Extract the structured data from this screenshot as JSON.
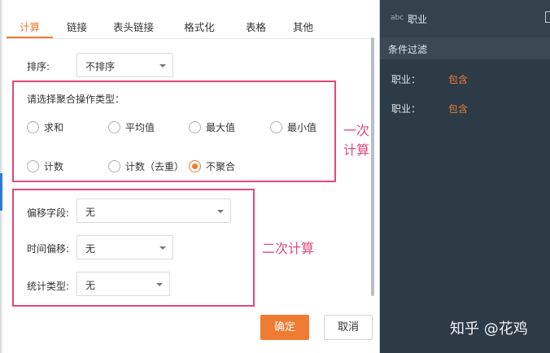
{
  "tabs": [
    "计算",
    "链接",
    "表头链接",
    "格式化",
    "表格",
    "其他"
  ],
  "sort": {
    "label": "排序:",
    "value": "不排序"
  },
  "aggregate": {
    "title": "请选择聚合操作类型：",
    "options": [
      "求和",
      "平均值",
      "最大值",
      "最小值",
      "计数",
      "计数（去重）",
      "不聚合"
    ],
    "selected": "不聚合"
  },
  "offset_field": {
    "label": "偏移字段:",
    "value": "无"
  },
  "time_offset": {
    "label": "时间偏移:",
    "value": "无"
  },
  "stat_type": {
    "label": "统计类型:",
    "value": "无"
  },
  "annotations": {
    "first": "一次计算",
    "second": "二次计算"
  },
  "buttons": {
    "ok": "确定",
    "cancel": "取消"
  },
  "right_panel": {
    "abc": "abc",
    "title": "职业",
    "section": "条件过滤",
    "rows": [
      {
        "label": "职业：",
        "value": "包含"
      },
      {
        "label": "职业：",
        "value": "包含"
      }
    ]
  },
  "watermark": "知乎 @花鸡",
  "colors": {
    "accent": "#f07b32",
    "highlight": "#e0497d",
    "panel_bg": "#2d3b46"
  }
}
